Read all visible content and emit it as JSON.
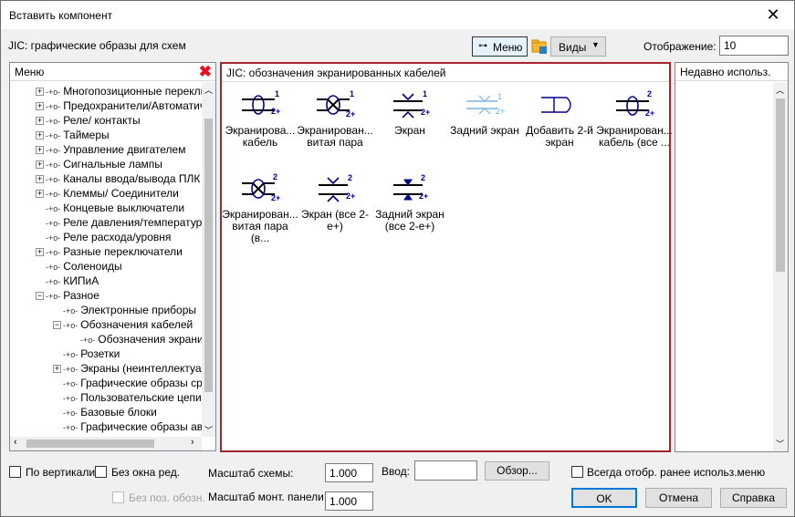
{
  "window": {
    "title": "Вставить компонент",
    "close": "✕"
  },
  "toolbar": {
    "library_label": "JIC: графические образы для схем",
    "menu_label": "Меню",
    "views_label": "Виды",
    "display_label": "Отображение:",
    "display_value": "10"
  },
  "menu_panel": {
    "title": "Меню",
    "items": [
      {
        "label": "Многопозиционные переклю",
        "expand": "+"
      },
      {
        "label": "Предохранители/Автоматич",
        "expand": "+"
      },
      {
        "label": "Реле/ контакты",
        "expand": "+"
      },
      {
        "label": "Таймеры",
        "expand": "+"
      },
      {
        "label": "Управление двигателем",
        "expand": "+"
      },
      {
        "label": "Сигнальные лампы",
        "expand": "+"
      },
      {
        "label": "Каналы ввода/вывода ПЛК",
        "expand": "+"
      },
      {
        "label": "Клеммы/ Соединители",
        "expand": "+"
      },
      {
        "label": "Концевые выключатели",
        "expand": ""
      },
      {
        "label": "Реле давления/температуры",
        "expand": ""
      },
      {
        "label": "Реле расхода/уровня",
        "expand": ""
      },
      {
        "label": "Разные переключатели",
        "expand": "+"
      },
      {
        "label": "Соленоиды",
        "expand": ""
      },
      {
        "label": "КИПиА",
        "expand": ""
      },
      {
        "label": "Разное",
        "expand": "−"
      },
      {
        "label": "Электронные приборы",
        "expand": ""
      },
      {
        "label": "Обозначения кабелей",
        "expand": "−"
      },
      {
        "label": "Обозначения экранир",
        "expand": ""
      },
      {
        "label": "Розетки",
        "expand": ""
      },
      {
        "label": "Экраны (неинтеллектуаль",
        "expand": "+"
      },
      {
        "label": "Графические образы сра",
        "expand": ""
      },
      {
        "label": "Пользовательские цепи",
        "expand": ""
      },
      {
        "label": "Базовые блоки",
        "expand": ""
      },
      {
        "label": "Графические образы авт",
        "expand": ""
      }
    ]
  },
  "components_panel": {
    "title": "JIC: обозначения экранированных кабелей",
    "items": [
      {
        "label": "Экранирова... кабель",
        "icon": "shielded-cable-icon"
      },
      {
        "label": "Экранирован... витая пара",
        "icon": "shielded-twisted-pair-icon"
      },
      {
        "label": "Экран",
        "icon": "shield-icon"
      },
      {
        "label": "Задний экран",
        "icon": "back-shield-icon"
      },
      {
        "label": "Добавить 2-й экран",
        "icon": "add-second-shield-icon"
      },
      {
        "label": "Экранирован... кабель (все ...",
        "icon": "shielded-cable-all-icon"
      },
      {
        "label": "Экранирован... витая пара (в...",
        "icon": "shielded-twisted-pair-all-icon"
      },
      {
        "label": "Экран (все 2-е+)",
        "icon": "shield-all-icon"
      },
      {
        "label": "Задний экран (все 2-е+)",
        "icon": "back-shield-all-icon"
      }
    ],
    "tag1": "1",
    "tag2": "2+",
    "tag2b": "2"
  },
  "recent_panel": {
    "title": "Недавно использ."
  },
  "bottom": {
    "vertical": "По вертикали",
    "no_edit": "Без окна ред.",
    "no_pos": "Без поз. обозн.",
    "scale_label": "Масштаб схемы:",
    "scale_value": "1.000",
    "panel_scale_label": "Масштаб монт. панели:",
    "panel_scale_value": "1.000",
    "input_label": "Ввод:",
    "input_value": "",
    "browse": "Обзор...",
    "always_show": "Всегда отобр. ранее использ.меню",
    "ok": "OK",
    "cancel": "Отмена",
    "help": "Справка"
  },
  "colors": {
    "accent_border": "#a4262c",
    "icon_blue": "#00008b",
    "delete_red": "#e81123"
  }
}
